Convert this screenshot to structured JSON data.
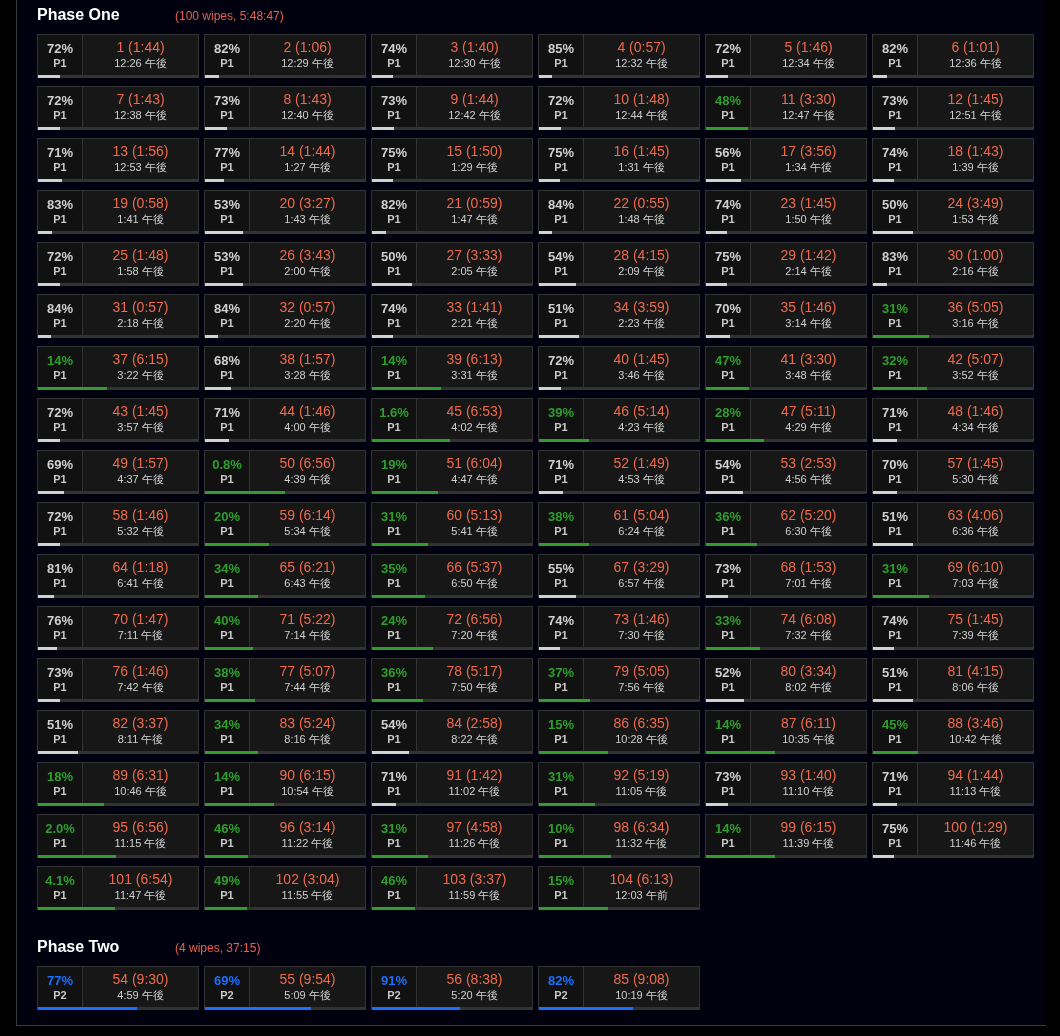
{
  "phases": [
    {
      "title": "Phase One",
      "summary": "(100 wipes, 5:48:47)",
      "pulls": [
        {
          "percent": "72%",
          "phase": "P1",
          "pull": "1 (1:44)",
          "time": "12:26 午後",
          "level": 0.14,
          "color": "#d0d0d0"
        },
        {
          "percent": "82%",
          "phase": "P1",
          "pull": "2 (1:06)",
          "time": "12:29 午後",
          "level": 0.09,
          "color": "#d0d0d0"
        },
        {
          "percent": "74%",
          "phase": "P1",
          "pull": "3 (1:40)",
          "time": "12:30 午後",
          "level": 0.13,
          "color": "#d0d0d0"
        },
        {
          "percent": "85%",
          "phase": "P1",
          "pull": "4 (0:57)",
          "time": "12:32 午後",
          "level": 0.08,
          "color": "#d0d0d0"
        },
        {
          "percent": "72%",
          "phase": "P1",
          "pull": "5 (1:46)",
          "time": "12:34 午後",
          "level": 0.14,
          "color": "#d0d0d0"
        },
        {
          "percent": "82%",
          "phase": "P1",
          "pull": "6 (1:01)",
          "time": "12:36 午後",
          "level": 0.09,
          "color": "#d0d0d0"
        },
        {
          "percent": "72%",
          "phase": "P1",
          "pull": "7 (1:43)",
          "time": "12:38 午後",
          "level": 0.14,
          "color": "#d0d0d0"
        },
        {
          "percent": "73%",
          "phase": "P1",
          "pull": "8 (1:43)",
          "time": "12:40 午後",
          "level": 0.14,
          "color": "#d0d0d0"
        },
        {
          "percent": "73%",
          "phase": "P1",
          "pull": "9 (1:44)",
          "time": "12:42 午後",
          "level": 0.14,
          "color": "#d0d0d0"
        },
        {
          "percent": "72%",
          "phase": "P1",
          "pull": "10 (1:48)",
          "time": "12:44 午後",
          "level": 0.14,
          "color": "#d0d0d0"
        },
        {
          "percent": "48%",
          "phase": "P1",
          "pull": "11 (3:30)",
          "time": "12:47 午後",
          "level": 0.26,
          "color": "#2e9e2e"
        },
        {
          "percent": "73%",
          "phase": "P1",
          "pull": "12 (1:45)",
          "time": "12:51 午後",
          "level": 0.14,
          "color": "#d0d0d0"
        },
        {
          "percent": "71%",
          "phase": "P1",
          "pull": "13 (1:56)",
          "time": "12:53 午後",
          "level": 0.15,
          "color": "#d0d0d0"
        },
        {
          "percent": "77%",
          "phase": "P1",
          "pull": "14 (1:44)",
          "time": "1:27 午後",
          "level": 0.12,
          "color": "#d0d0d0"
        },
        {
          "percent": "75%",
          "phase": "P1",
          "pull": "15 (1:50)",
          "time": "1:29 午後",
          "level": 0.13,
          "color": "#d0d0d0"
        },
        {
          "percent": "75%",
          "phase": "P1",
          "pull": "16 (1:45)",
          "time": "1:31 午後",
          "level": 0.13,
          "color": "#d0d0d0"
        },
        {
          "percent": "56%",
          "phase": "P1",
          "pull": "17 (3:56)",
          "time": "1:34 午後",
          "level": 0.22,
          "color": "#d0d0d0"
        },
        {
          "percent": "74%",
          "phase": "P1",
          "pull": "18 (1:43)",
          "time": "1:39 午後",
          "level": 0.13,
          "color": "#d0d0d0"
        },
        {
          "percent": "83%",
          "phase": "P1",
          "pull": "19 (0:58)",
          "time": "1:41 午後",
          "level": 0.09,
          "color": "#d0d0d0"
        },
        {
          "percent": "53%",
          "phase": "P1",
          "pull": "20 (3:27)",
          "time": "1:43 午後",
          "level": 0.24,
          "color": "#d0d0d0"
        },
        {
          "percent": "82%",
          "phase": "P1",
          "pull": "21 (0:59)",
          "time": "1:47 午後",
          "level": 0.09,
          "color": "#d0d0d0"
        },
        {
          "percent": "84%",
          "phase": "P1",
          "pull": "22 (0:55)",
          "time": "1:48 午後",
          "level": 0.08,
          "color": "#d0d0d0"
        },
        {
          "percent": "74%",
          "phase": "P1",
          "pull": "23 (1:45)",
          "time": "1:50 午後",
          "level": 0.13,
          "color": "#d0d0d0"
        },
        {
          "percent": "50%",
          "phase": "P1",
          "pull": "24 (3:49)",
          "time": "1:53 午後",
          "level": 0.25,
          "color": "#d0d0d0"
        },
        {
          "percent": "72%",
          "phase": "P1",
          "pull": "25 (1:48)",
          "time": "1:58 午後",
          "level": 0.14,
          "color": "#d0d0d0"
        },
        {
          "percent": "53%",
          "phase": "P1",
          "pull": "26 (3:43)",
          "time": "2:00 午後",
          "level": 0.24,
          "color": "#d0d0d0"
        },
        {
          "percent": "50%",
          "phase": "P1",
          "pull": "27 (3:33)",
          "time": "2:05 午後",
          "level": 0.25,
          "color": "#d0d0d0"
        },
        {
          "percent": "54%",
          "phase": "P1",
          "pull": "28 (4:15)",
          "time": "2:09 午後",
          "level": 0.23,
          "color": "#d0d0d0"
        },
        {
          "percent": "75%",
          "phase": "P1",
          "pull": "29 (1:42)",
          "time": "2:14 午後",
          "level": 0.13,
          "color": "#d0d0d0"
        },
        {
          "percent": "83%",
          "phase": "P1",
          "pull": "30 (1:00)",
          "time": "2:16 午後",
          "level": 0.09,
          "color": "#d0d0d0"
        },
        {
          "percent": "84%",
          "phase": "P1",
          "pull": "31 (0:57)",
          "time": "2:18 午後",
          "level": 0.08,
          "color": "#d0d0d0"
        },
        {
          "percent": "84%",
          "phase": "P1",
          "pull": "32 (0:57)",
          "time": "2:20 午後",
          "level": 0.08,
          "color": "#d0d0d0"
        },
        {
          "percent": "74%",
          "phase": "P1",
          "pull": "33 (1:41)",
          "time": "2:21 午後",
          "level": 0.13,
          "color": "#d0d0d0"
        },
        {
          "percent": "51%",
          "phase": "P1",
          "pull": "34 (3:59)",
          "time": "2:23 午後",
          "level": 0.25,
          "color": "#d0d0d0"
        },
        {
          "percent": "70%",
          "phase": "P1",
          "pull": "35 (1:46)",
          "time": "3:14 午後",
          "level": 0.15,
          "color": "#d0d0d0"
        },
        {
          "percent": "31%",
          "phase": "P1",
          "pull": "36 (5:05)",
          "time": "3:16 午後",
          "level": 0.35,
          "color": "#2e9e2e"
        },
        {
          "percent": "14%",
          "phase": "P1",
          "pull": "37 (6:15)",
          "time": "3:22 午後",
          "level": 0.43,
          "color": "#2e9e2e"
        },
        {
          "percent": "68%",
          "phase": "P1",
          "pull": "38 (1:57)",
          "time": "3:28 午後",
          "level": 0.16,
          "color": "#d0d0d0"
        },
        {
          "percent": "14%",
          "phase": "P1",
          "pull": "39 (6:13)",
          "time": "3:31 午後",
          "level": 0.43,
          "color": "#2e9e2e"
        },
        {
          "percent": "72%",
          "phase": "P1",
          "pull": "40 (1:45)",
          "time": "3:46 午後",
          "level": 0.14,
          "color": "#d0d0d0"
        },
        {
          "percent": "47%",
          "phase": "P1",
          "pull": "41 (3:30)",
          "time": "3:48 午後",
          "level": 0.27,
          "color": "#2e9e2e"
        },
        {
          "percent": "32%",
          "phase": "P1",
          "pull": "42 (5:07)",
          "time": "3:52 午後",
          "level": 0.34,
          "color": "#2e9e2e"
        },
        {
          "percent": "72%",
          "phase": "P1",
          "pull": "43 (1:45)",
          "time": "3:57 午後",
          "level": 0.14,
          "color": "#d0d0d0"
        },
        {
          "percent": "71%",
          "phase": "P1",
          "pull": "44 (1:46)",
          "time": "4:00 午後",
          "level": 0.15,
          "color": "#d0d0d0"
        },
        {
          "percent": "1.6%",
          "phase": "P1",
          "pull": "45 (6:53)",
          "time": "4:02 午後",
          "level": 0.49,
          "color": "#2e9e2e"
        },
        {
          "percent": "39%",
          "phase": "P1",
          "pull": "46 (5:14)",
          "time": "4:23 午後",
          "level": 0.31,
          "color": "#2e9e2e"
        },
        {
          "percent": "28%",
          "phase": "P1",
          "pull": "47 (5:11)",
          "time": "4:29 午後",
          "level": 0.36,
          "color": "#2e9e2e"
        },
        {
          "percent": "71%",
          "phase": "P1",
          "pull": "48 (1:46)",
          "time": "4:34 午後",
          "level": 0.15,
          "color": "#d0d0d0"
        },
        {
          "percent": "69%",
          "phase": "P1",
          "pull": "49 (1:57)",
          "time": "4:37 午後",
          "level": 0.16,
          "color": "#d0d0d0"
        },
        {
          "percent": "0.8%",
          "phase": "P1",
          "pull": "50 (6:56)",
          "time": "4:39 午後",
          "level": 0.5,
          "color": "#2e9e2e"
        },
        {
          "percent": "19%",
          "phase": "P1",
          "pull": "51 (6:04)",
          "time": "4:47 午後",
          "level": 0.41,
          "color": "#2e9e2e"
        },
        {
          "percent": "71%",
          "phase": "P1",
          "pull": "52 (1:49)",
          "time": "4:53 午後",
          "level": 0.15,
          "color": "#d0d0d0"
        },
        {
          "percent": "54%",
          "phase": "P1",
          "pull": "53 (2:53)",
          "time": "4:56 午後",
          "level": 0.23,
          "color": "#d0d0d0"
        },
        {
          "percent": "70%",
          "phase": "P1",
          "pull": "57 (1:45)",
          "time": "5:30 午後",
          "level": 0.15,
          "color": "#d0d0d0"
        },
        {
          "percent": "72%",
          "phase": "P1",
          "pull": "58 (1:46)",
          "time": "5:32 午後",
          "level": 0.14,
          "color": "#d0d0d0"
        },
        {
          "percent": "20%",
          "phase": "P1",
          "pull": "59 (6:14)",
          "time": "5:34 午後",
          "level": 0.4,
          "color": "#2e9e2e"
        },
        {
          "percent": "31%",
          "phase": "P1",
          "pull": "60 (5:13)",
          "time": "5:41 午後",
          "level": 0.35,
          "color": "#2e9e2e"
        },
        {
          "percent": "38%",
          "phase": "P1",
          "pull": "61 (5:04)",
          "time": "6:24 午後",
          "level": 0.31,
          "color": "#2e9e2e"
        },
        {
          "percent": "36%",
          "phase": "P1",
          "pull": "62 (5:20)",
          "time": "6:30 午後",
          "level": 0.32,
          "color": "#2e9e2e"
        },
        {
          "percent": "51%",
          "phase": "P1",
          "pull": "63 (4:06)",
          "time": "6:36 午後",
          "level": 0.25,
          "color": "#d0d0d0"
        },
        {
          "percent": "81%",
          "phase": "P1",
          "pull": "64 (1:18)",
          "time": "6:41 午後",
          "level": 0.1,
          "color": "#d0d0d0"
        },
        {
          "percent": "34%",
          "phase": "P1",
          "pull": "65 (6:21)",
          "time": "6:43 午後",
          "level": 0.33,
          "color": "#2e9e2e"
        },
        {
          "percent": "35%",
          "phase": "P1",
          "pull": "66 (5:37)",
          "time": "6:50 午後",
          "level": 0.33,
          "color": "#2e9e2e"
        },
        {
          "percent": "55%",
          "phase": "P1",
          "pull": "67 (3:29)",
          "time": "6:57 午後",
          "level": 0.23,
          "color": "#d0d0d0"
        },
        {
          "percent": "73%",
          "phase": "P1",
          "pull": "68 (1:53)",
          "time": "7:01 午後",
          "level": 0.14,
          "color": "#d0d0d0"
        },
        {
          "percent": "31%",
          "phase": "P1",
          "pull": "69 (6:10)",
          "time": "7:03 午後",
          "level": 0.35,
          "color": "#2e9e2e"
        },
        {
          "percent": "76%",
          "phase": "P1",
          "pull": "70 (1:47)",
          "time": "7:11 午後",
          "level": 0.12,
          "color": "#d0d0d0"
        },
        {
          "percent": "40%",
          "phase": "P1",
          "pull": "71 (5:22)",
          "time": "7:14 午後",
          "level": 0.3,
          "color": "#2e9e2e"
        },
        {
          "percent": "24%",
          "phase": "P1",
          "pull": "72 (6:56)",
          "time": "7:20 午後",
          "level": 0.38,
          "color": "#2e9e2e"
        },
        {
          "percent": "74%",
          "phase": "P1",
          "pull": "73 (1:46)",
          "time": "7:30 午後",
          "level": 0.13,
          "color": "#d0d0d0"
        },
        {
          "percent": "33%",
          "phase": "P1",
          "pull": "74 (6:08)",
          "time": "7:32 午後",
          "level": 0.34,
          "color": "#2e9e2e"
        },
        {
          "percent": "74%",
          "phase": "P1",
          "pull": "75 (1:45)",
          "time": "7:39 午後",
          "level": 0.13,
          "color": "#d0d0d0"
        },
        {
          "percent": "73%",
          "phase": "P1",
          "pull": "76 (1:46)",
          "time": "7:42 午後",
          "level": 0.14,
          "color": "#d0d0d0"
        },
        {
          "percent": "38%",
          "phase": "P1",
          "pull": "77 (5:07)",
          "time": "7:44 午後",
          "level": 0.31,
          "color": "#2e9e2e"
        },
        {
          "percent": "36%",
          "phase": "P1",
          "pull": "78 (5:17)",
          "time": "7:50 午後",
          "level": 0.32,
          "color": "#2e9e2e"
        },
        {
          "percent": "37%",
          "phase": "P1",
          "pull": "79 (5:05)",
          "time": "7:56 午後",
          "level": 0.32,
          "color": "#2e9e2e"
        },
        {
          "percent": "52%",
          "phase": "P1",
          "pull": "80 (3:34)",
          "time": "8:02 午後",
          "level": 0.24,
          "color": "#d0d0d0"
        },
        {
          "percent": "51%",
          "phase": "P1",
          "pull": "81 (4:15)",
          "time": "8:06 午後",
          "level": 0.25,
          "color": "#d0d0d0"
        },
        {
          "percent": "51%",
          "phase": "P1",
          "pull": "82 (3:37)",
          "time": "8:11 午後",
          "level": 0.25,
          "color": "#d0d0d0"
        },
        {
          "percent": "34%",
          "phase": "P1",
          "pull": "83 (5:24)",
          "time": "8:16 午後",
          "level": 0.33,
          "color": "#2e9e2e"
        },
        {
          "percent": "54%",
          "phase": "P1",
          "pull": "84 (2:58)",
          "time": "8:22 午後",
          "level": 0.23,
          "color": "#d0d0d0"
        },
        {
          "percent": "15%",
          "phase": "P1",
          "pull": "86 (6:35)",
          "time": "10:28 午後",
          "level": 0.43,
          "color": "#2e9e2e"
        },
        {
          "percent": "14%",
          "phase": "P1",
          "pull": "87 (6:11)",
          "time": "10:35 午後",
          "level": 0.43,
          "color": "#2e9e2e"
        },
        {
          "percent": "45%",
          "phase": "P1",
          "pull": "88 (3:46)",
          "time": "10:42 午後",
          "level": 0.28,
          "color": "#2e9e2e"
        },
        {
          "percent": "18%",
          "phase": "P1",
          "pull": "89 (6:31)",
          "time": "10:46 午後",
          "level": 0.41,
          "color": "#2e9e2e"
        },
        {
          "percent": "14%",
          "phase": "P1",
          "pull": "90 (6:15)",
          "time": "10:54 午後",
          "level": 0.43,
          "color": "#2e9e2e"
        },
        {
          "percent": "71%",
          "phase": "P1",
          "pull": "91 (1:42)",
          "time": "11:02 午後",
          "level": 0.15,
          "color": "#d0d0d0"
        },
        {
          "percent": "31%",
          "phase": "P1",
          "pull": "92 (5:19)",
          "time": "11:05 午後",
          "level": 0.35,
          "color": "#2e9e2e"
        },
        {
          "percent": "73%",
          "phase": "P1",
          "pull": "93 (1:40)",
          "time": "11:10 午後",
          "level": 0.14,
          "color": "#d0d0d0"
        },
        {
          "percent": "71%",
          "phase": "P1",
          "pull": "94 (1:44)",
          "time": "11:13 午後",
          "level": 0.15,
          "color": "#d0d0d0"
        },
        {
          "percent": "2.0%",
          "phase": "P1",
          "pull": "95 (6:56)",
          "time": "11:15 午後",
          "level": 0.49,
          "color": "#2e9e2e"
        },
        {
          "percent": "46%",
          "phase": "P1",
          "pull": "96 (3:14)",
          "time": "11:22 午後",
          "level": 0.27,
          "color": "#2e9e2e"
        },
        {
          "percent": "31%",
          "phase": "P1",
          "pull": "97 (4:58)",
          "time": "11:26 午後",
          "level": 0.35,
          "color": "#2e9e2e"
        },
        {
          "percent": "10%",
          "phase": "P1",
          "pull": "98 (6:34)",
          "time": "11:32 午後",
          "level": 0.45,
          "color": "#2e9e2e"
        },
        {
          "percent": "14%",
          "phase": "P1",
          "pull": "99 (6:15)",
          "time": "11:39 午後",
          "level": 0.43,
          "color": "#2e9e2e"
        },
        {
          "percent": "75%",
          "phase": "P1",
          "pull": "100 (1:29)",
          "time": "11:46 午後",
          "level": 0.13,
          "color": "#d0d0d0"
        },
        {
          "percent": "4.1%",
          "phase": "P1",
          "pull": "101 (6:54)",
          "time": "11:47 午後",
          "level": 0.48,
          "color": "#2e9e2e"
        },
        {
          "percent": "49%",
          "phase": "P1",
          "pull": "102 (3:04)",
          "time": "11:55 午後",
          "level": 0.26,
          "color": "#2e9e2e"
        },
        {
          "percent": "46%",
          "phase": "P1",
          "pull": "103 (3:37)",
          "time": "11:59 午後",
          "level": 0.27,
          "color": "#2e9e2e"
        },
        {
          "percent": "15%",
          "phase": "P1",
          "pull": "104 (6:13)",
          "time": "12:03 午前",
          "level": 0.43,
          "color": "#2e9e2e"
        }
      ]
    },
    {
      "title": "Phase Two",
      "summary": "(4 wipes, 37:15)",
      "pulls": [
        {
          "percent": "77%",
          "phase": "P2",
          "pull": "54 (9:30)",
          "time": "4:59 午後",
          "level": 0.62,
          "color": "#1a6fff"
        },
        {
          "percent": "69%",
          "phase": "P2",
          "pull": "55 (9:54)",
          "time": "5:09 午後",
          "level": 0.66,
          "color": "#1a6fff"
        },
        {
          "percent": "91%",
          "phase": "P2",
          "pull": "56 (8:38)",
          "time": "5:20 午後",
          "level": 0.55,
          "color": "#1a6fff"
        },
        {
          "percent": "82%",
          "phase": "P2",
          "pull": "85 (9:08)",
          "time": "10:19 午後",
          "level": 0.59,
          "color": "#1a6fff"
        }
      ]
    }
  ]
}
